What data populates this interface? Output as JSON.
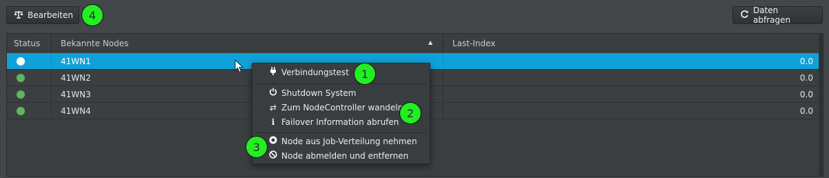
{
  "toolbar": {
    "edit_label": "Bearbeiten",
    "edit_icon": "scale-icon",
    "fetch_label": "Daten abfragen",
    "fetch_icon": "refresh-icon"
  },
  "badges": {
    "b1": "1",
    "b2": "2",
    "b3": "3",
    "b4": "4"
  },
  "grid": {
    "headers": {
      "status": "Status",
      "nodes": "Bekannte Nodes",
      "last_index": "Last-Index"
    },
    "sort": "ascending",
    "rows": [
      {
        "name": "41WN1",
        "status": "white",
        "last_index": "0.0",
        "selected": true
      },
      {
        "name": "41WN2",
        "status": "green",
        "last_index": "0.0",
        "selected": false
      },
      {
        "name": "41WN3",
        "status": "green",
        "last_index": "0.0",
        "selected": false
      },
      {
        "name": "41WN4",
        "status": "green",
        "last_index": "0.0",
        "selected": false
      }
    ]
  },
  "context_menu": {
    "items": [
      {
        "label": "Verbindungstest",
        "icon": "plug-icon"
      },
      {
        "label": "Shutdown System",
        "icon": "power-icon"
      },
      {
        "label": "Zum NodeController wandeln",
        "icon": "exchange-icon"
      },
      {
        "label": "Failover Information abrufen",
        "icon": "info-icon"
      },
      {
        "label": "Node aus Job-Verteilung nehmen",
        "icon": "stop-circle-icon"
      },
      {
        "label": "Node abmelden und entfernen",
        "icon": "ban-icon"
      }
    ]
  },
  "colors": {
    "background": "#434749",
    "selected_row": "#0fa2d9",
    "status_green": "#5cb85c",
    "status_white": "#ffffff",
    "badge": "#22ee22"
  }
}
